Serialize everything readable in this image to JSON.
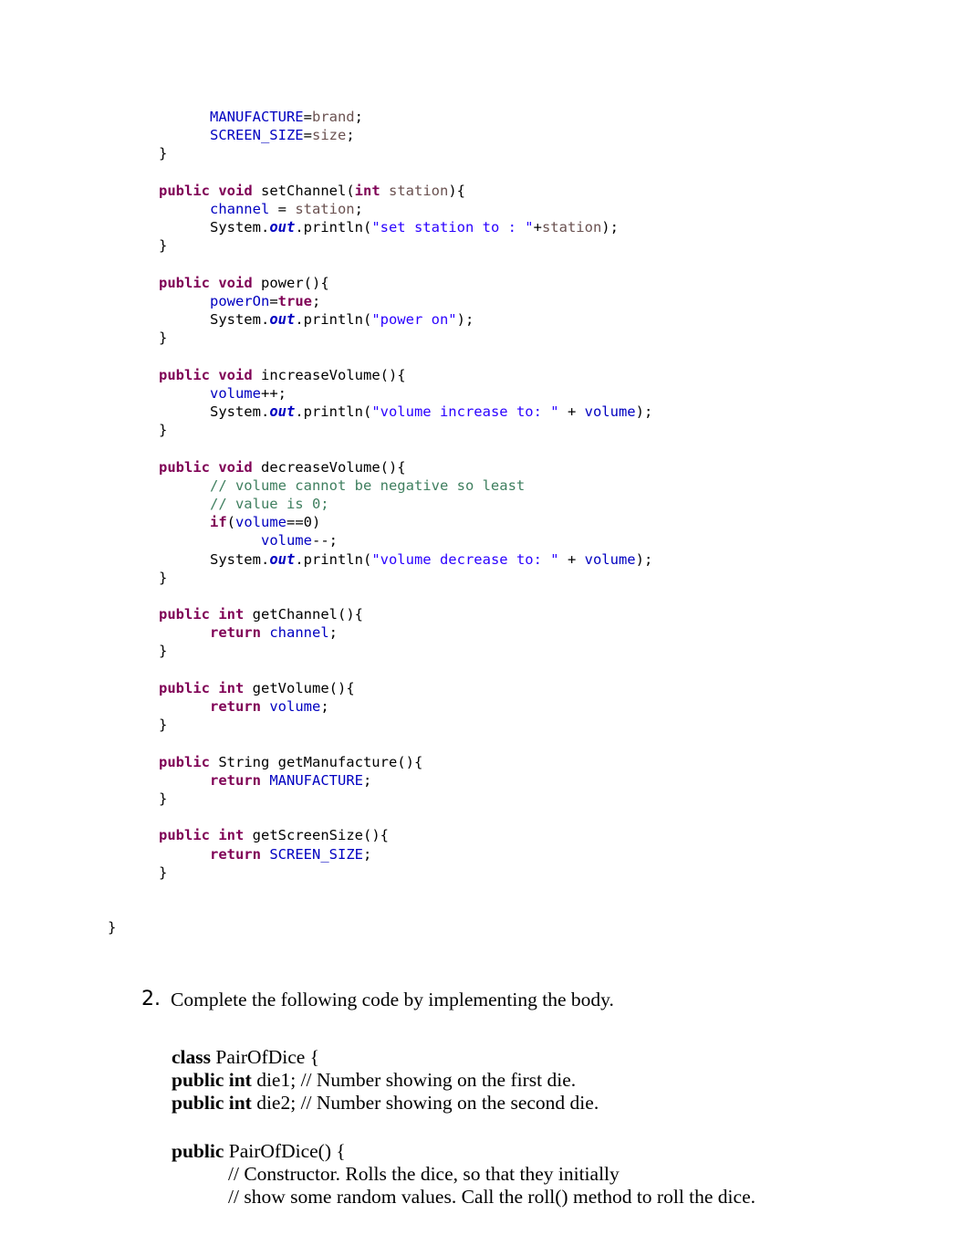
{
  "document": {
    "background_color": "#ffffff",
    "text_color": "#000000"
  },
  "syntax_colors": {
    "keyword": "#7f0055",
    "field": "#0000c0",
    "string": "#2a00ff",
    "comment": "#3f7f5f",
    "parameter": "#6a5150",
    "plain": "#000000"
  },
  "code_listing": {
    "language": "java",
    "lines": [
      {
        "indent": 2,
        "tokens": [
          {
            "t": "MANUFACTURE",
            "c": "fld"
          },
          {
            "t": "=",
            "c": "pln"
          },
          {
            "t": "brand",
            "c": "prm"
          },
          {
            "t": ";",
            "c": "pln"
          }
        ]
      },
      {
        "indent": 2,
        "tokens": [
          {
            "t": "SCREEN_SIZE",
            "c": "fld"
          },
          {
            "t": "=",
            "c": "pln"
          },
          {
            "t": "size",
            "c": "prm"
          },
          {
            "t": ";",
            "c": "pln"
          }
        ]
      },
      {
        "indent": 1,
        "tokens": [
          {
            "t": "}",
            "c": "pln"
          }
        ]
      },
      {
        "indent": 0,
        "tokens": []
      },
      {
        "indent": 1,
        "tokens": [
          {
            "t": "public",
            "c": "kw"
          },
          {
            "t": " ",
            "c": "pln"
          },
          {
            "t": "void",
            "c": "kw"
          },
          {
            "t": " setChannel(",
            "c": "pln"
          },
          {
            "t": "int",
            "c": "kw"
          },
          {
            "t": " ",
            "c": "pln"
          },
          {
            "t": "station",
            "c": "prm"
          },
          {
            "t": "){",
            "c": "pln"
          }
        ]
      },
      {
        "indent": 2,
        "tokens": [
          {
            "t": "channel",
            "c": "fld"
          },
          {
            "t": " = ",
            "c": "pln"
          },
          {
            "t": "station",
            "c": "prm"
          },
          {
            "t": ";",
            "c": "pln"
          }
        ]
      },
      {
        "indent": 2,
        "tokens": [
          {
            "t": "System.",
            "c": "pln"
          },
          {
            "t": "out",
            "c": "outfld"
          },
          {
            "t": ".println(",
            "c": "pln"
          },
          {
            "t": "\"set station to : \"",
            "c": "str"
          },
          {
            "t": "+",
            "c": "pln"
          },
          {
            "t": "station",
            "c": "prm"
          },
          {
            "t": ");",
            "c": "pln"
          }
        ]
      },
      {
        "indent": 1,
        "tokens": [
          {
            "t": "}",
            "c": "pln"
          }
        ]
      },
      {
        "indent": 0,
        "tokens": []
      },
      {
        "indent": 1,
        "tokens": [
          {
            "t": "public",
            "c": "kw"
          },
          {
            "t": " ",
            "c": "pln"
          },
          {
            "t": "void",
            "c": "kw"
          },
          {
            "t": " power(){",
            "c": "pln"
          }
        ]
      },
      {
        "indent": 2,
        "tokens": [
          {
            "t": "powerOn",
            "c": "fld"
          },
          {
            "t": "=",
            "c": "pln"
          },
          {
            "t": "true",
            "c": "kw"
          },
          {
            "t": ";",
            "c": "pln"
          }
        ]
      },
      {
        "indent": 2,
        "tokens": [
          {
            "t": "System.",
            "c": "pln"
          },
          {
            "t": "out",
            "c": "outfld"
          },
          {
            "t": ".println(",
            "c": "pln"
          },
          {
            "t": "\"power on\"",
            "c": "str"
          },
          {
            "t": ");",
            "c": "pln"
          }
        ]
      },
      {
        "indent": 1,
        "tokens": [
          {
            "t": "}",
            "c": "pln"
          }
        ]
      },
      {
        "indent": 0,
        "tokens": []
      },
      {
        "indent": 1,
        "tokens": [
          {
            "t": "public",
            "c": "kw"
          },
          {
            "t": " ",
            "c": "pln"
          },
          {
            "t": "void",
            "c": "kw"
          },
          {
            "t": " increaseVolume(){",
            "c": "pln"
          }
        ]
      },
      {
        "indent": 2,
        "tokens": [
          {
            "t": "volume",
            "c": "fld"
          },
          {
            "t": "++;",
            "c": "pln"
          }
        ]
      },
      {
        "indent": 2,
        "tokens": [
          {
            "t": "System.",
            "c": "pln"
          },
          {
            "t": "out",
            "c": "outfld"
          },
          {
            "t": ".println(",
            "c": "pln"
          },
          {
            "t": "\"volume increase to: \"",
            "c": "str"
          },
          {
            "t": " + ",
            "c": "pln"
          },
          {
            "t": "volume",
            "c": "fld"
          },
          {
            "t": ");",
            "c": "pln"
          }
        ]
      },
      {
        "indent": 1,
        "tokens": [
          {
            "t": "}",
            "c": "pln"
          }
        ]
      },
      {
        "indent": 0,
        "tokens": []
      },
      {
        "indent": 1,
        "tokens": [
          {
            "t": "public",
            "c": "kw"
          },
          {
            "t": " ",
            "c": "pln"
          },
          {
            "t": "void",
            "c": "kw"
          },
          {
            "t": " decreaseVolume(){",
            "c": "pln"
          }
        ]
      },
      {
        "indent": 2,
        "tokens": [
          {
            "t": "// volume cannot be negative so least",
            "c": "cmt"
          }
        ]
      },
      {
        "indent": 2,
        "tokens": [
          {
            "t": "// value is 0;",
            "c": "cmt"
          }
        ]
      },
      {
        "indent": 2,
        "tokens": [
          {
            "t": "if",
            "c": "kw"
          },
          {
            "t": "(",
            "c": "pln"
          },
          {
            "t": "volume",
            "c": "fld"
          },
          {
            "t": "==0)",
            "c": "pln"
          }
        ]
      },
      {
        "indent": 3,
        "tokens": [
          {
            "t": "volume",
            "c": "fld"
          },
          {
            "t": "--;",
            "c": "pln"
          }
        ]
      },
      {
        "indent": 2,
        "tokens": [
          {
            "t": "System.",
            "c": "pln"
          },
          {
            "t": "out",
            "c": "outfld"
          },
          {
            "t": ".println(",
            "c": "pln"
          },
          {
            "t": "\"volume decrease to: \"",
            "c": "str"
          },
          {
            "t": " + ",
            "c": "pln"
          },
          {
            "t": "volume",
            "c": "fld"
          },
          {
            "t": ");",
            "c": "pln"
          }
        ]
      },
      {
        "indent": 1,
        "tokens": [
          {
            "t": "}",
            "c": "pln"
          }
        ]
      },
      {
        "indent": 0,
        "tokens": []
      },
      {
        "indent": 1,
        "tokens": [
          {
            "t": "public",
            "c": "kw"
          },
          {
            "t": " ",
            "c": "pln"
          },
          {
            "t": "int",
            "c": "kw"
          },
          {
            "t": " getChannel(){",
            "c": "pln"
          }
        ]
      },
      {
        "indent": 2,
        "tokens": [
          {
            "t": "return",
            "c": "kw"
          },
          {
            "t": " ",
            "c": "pln"
          },
          {
            "t": "channel",
            "c": "fld"
          },
          {
            "t": ";",
            "c": "pln"
          }
        ]
      },
      {
        "indent": 1,
        "tokens": [
          {
            "t": "}",
            "c": "pln"
          }
        ]
      },
      {
        "indent": 0,
        "tokens": []
      },
      {
        "indent": 1,
        "tokens": [
          {
            "t": "public",
            "c": "kw"
          },
          {
            "t": " ",
            "c": "pln"
          },
          {
            "t": "int",
            "c": "kw"
          },
          {
            "t": " getVolume(){",
            "c": "pln"
          }
        ]
      },
      {
        "indent": 2,
        "tokens": [
          {
            "t": "return",
            "c": "kw"
          },
          {
            "t": " ",
            "c": "pln"
          },
          {
            "t": "volume",
            "c": "fld"
          },
          {
            "t": ";",
            "c": "pln"
          }
        ]
      },
      {
        "indent": 1,
        "tokens": [
          {
            "t": "}",
            "c": "pln"
          }
        ]
      },
      {
        "indent": 0,
        "tokens": []
      },
      {
        "indent": 1,
        "tokens": [
          {
            "t": "public",
            "c": "kw"
          },
          {
            "t": " String getManufacture(){",
            "c": "pln"
          }
        ]
      },
      {
        "indent": 2,
        "tokens": [
          {
            "t": "return",
            "c": "kw"
          },
          {
            "t": " ",
            "c": "pln"
          },
          {
            "t": "MANUFACTURE",
            "c": "fld"
          },
          {
            "t": ";",
            "c": "pln"
          }
        ]
      },
      {
        "indent": 1,
        "tokens": [
          {
            "t": "}",
            "c": "pln"
          }
        ]
      },
      {
        "indent": 0,
        "tokens": []
      },
      {
        "indent": 1,
        "tokens": [
          {
            "t": "public",
            "c": "kw"
          },
          {
            "t": " ",
            "c": "pln"
          },
          {
            "t": "int",
            "c": "kw"
          },
          {
            "t": " getScreenSize(){",
            "c": "pln"
          }
        ]
      },
      {
        "indent": 2,
        "tokens": [
          {
            "t": "return",
            "c": "kw"
          },
          {
            "t": " ",
            "c": "pln"
          },
          {
            "t": "SCREEN_SIZE",
            "c": "fld"
          },
          {
            "t": ";",
            "c": "pln"
          }
        ]
      },
      {
        "indent": 1,
        "tokens": [
          {
            "t": "}",
            "c": "pln"
          }
        ]
      },
      {
        "indent": 0,
        "tokens": []
      },
      {
        "indent": 0,
        "tokens": []
      },
      {
        "indent": 0,
        "tokens": [
          {
            "t": "}",
            "c": "pln"
          }
        ]
      }
    ]
  },
  "question_two": {
    "number": "2.",
    "prompt": "Complete the following code by implementing the body.",
    "code_lines": [
      {
        "indent": 0,
        "segments": [
          {
            "t": "class ",
            "b": true
          },
          {
            "t": "PairOfDice {",
            "b": false
          }
        ]
      },
      {
        "indent": 0,
        "segments": [
          {
            "t": "public int ",
            "b": true
          },
          {
            "t": "die1; // Number showing on the first die.",
            "b": false
          }
        ]
      },
      {
        "indent": 0,
        "segments": [
          {
            "t": "public int ",
            "b": true
          },
          {
            "t": "die2; // Number showing on the second die.",
            "b": false
          }
        ]
      },
      {
        "gap": true
      },
      {
        "indent": 0,
        "segments": [
          {
            "t": "public ",
            "b": true
          },
          {
            "t": "PairOfDice() {",
            "b": false
          }
        ]
      },
      {
        "indent": 1,
        "segments": [
          {
            "t": "// Constructor. Rolls the dice, so that they initially",
            "b": false
          }
        ]
      },
      {
        "indent": 1,
        "segments": [
          {
            "t": "// show some random values. Call the roll() method to roll the dice.",
            "b": false
          }
        ]
      }
    ]
  }
}
